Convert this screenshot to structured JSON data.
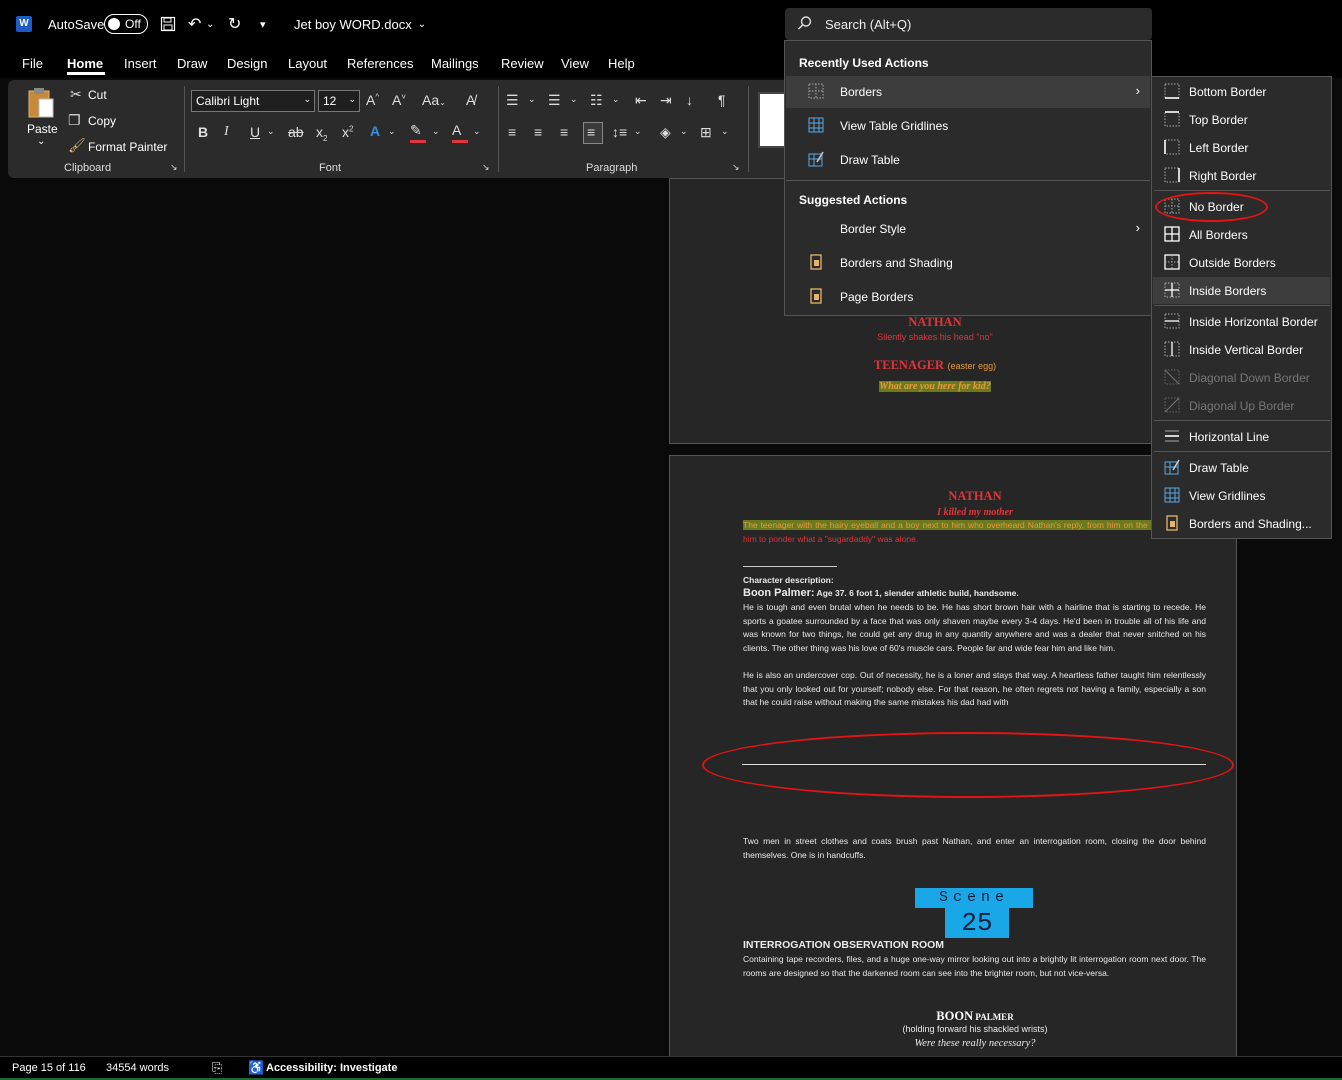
{
  "titlebar": {
    "autosave_label": "AutoSave",
    "autosave_state": "Off",
    "doc_title": "Jet boy WORD.docx"
  },
  "search": {
    "placeholder": "Search (Alt+Q)"
  },
  "tabs": [
    "File",
    "Home",
    "Insert",
    "Draw",
    "Design",
    "Layout",
    "References",
    "Mailings",
    "Review",
    "View",
    "Help"
  ],
  "ribbon": {
    "paste": "Paste",
    "cut": "Cut",
    "copy": "Copy",
    "format_painter": "Format Painter",
    "clipboard": "Clipboard",
    "font_name": "Calibri Light",
    "font_size": "12",
    "font_group": "Font",
    "paragraph_group": "Paragraph"
  },
  "search_menu": {
    "recent_heading": "Recently Used Actions",
    "recent": [
      {
        "label": "Borders",
        "icon": "borders-icon",
        "submenu": true
      },
      {
        "label": "View Table Gridlines",
        "icon": "table-gridlines-icon"
      },
      {
        "label": "Draw Table",
        "icon": "draw-table-icon"
      }
    ],
    "suggested_heading": "Suggested Actions",
    "suggested": [
      {
        "label": "Border Style",
        "icon": "",
        "submenu": true
      },
      {
        "label": "Borders and Shading",
        "icon": "document-icon"
      },
      {
        "label": "Page Borders",
        "icon": "document-icon"
      }
    ]
  },
  "border_menu": {
    "items": [
      {
        "label": "Bottom Border",
        "accel": "B",
        "rest": "ottom Border"
      },
      {
        "label": "Top Border",
        "accel": "P",
        "pre": "To",
        "rest": " Border"
      },
      {
        "label": "Left Border",
        "accel": "L",
        "rest": "eft Border"
      },
      {
        "label": "Right Border",
        "accel": "R",
        "rest": "ight Border"
      },
      {
        "label": "No Border",
        "accel": "N",
        "rest": "o Border"
      },
      {
        "label": "All Borders",
        "accel": "A",
        "rest": "ll Borders"
      },
      {
        "label": "Outside Borders",
        "accel": "S",
        "pre": "Out",
        "rest": "ide Borders"
      },
      {
        "label": "Inside Borders",
        "accel": "I",
        "rest": "nside Borders"
      },
      {
        "label": "Inside Horizontal Border",
        "accel": "H",
        "pre": "Inside ",
        "rest": "orizontal Border"
      },
      {
        "label": "Inside Vertical Border",
        "accel": "V",
        "pre": "Inside ",
        "rest": "ertical Border"
      },
      {
        "label": "Diagonal Down Border",
        "accel": "W",
        "pre": "Diagonal Do",
        "rest": "n Border"
      },
      {
        "label": "Diagonal Up Border",
        "accel": "U",
        "pre": "Diagonal ",
        "rest": "p Border"
      },
      {
        "label": "Horizontal Line",
        "accel": "Z",
        "pre": "Hori",
        "rest": "ontal Line"
      },
      {
        "label": "Draw Table",
        "accel": "D",
        "rest": "raw Table"
      },
      {
        "label": "View Gridlines",
        "accel": "G",
        "pre": "View ",
        "rest": "ridlines"
      },
      {
        "label": "Borders and Shading...",
        "accel": "O",
        "pre": "B",
        "rest": "rders and Shading..."
      }
    ]
  },
  "page1": {
    "nathan": "NATHAN",
    "nathan_action": "Silently shakes his head \"no\"",
    "teenager": "TEENAGER",
    "teenager_note": "(easter egg)",
    "teenager_line": "What are you here for kid?"
  },
  "page2": {
    "nathan": "NATHAN",
    "nathan_line": "I killed my mother",
    "highlight_text": "The teenager with the hairy eyeball and a boy next to him who overheard Nathan's reply, from him on the bench,",
    "after_highlight": " leaving him to ponder what a \"sugardaddy\" was alone.",
    "char_desc_label": "Character description:",
    "boon_heading": "Boon  Palmer:",
    "boon_detail": " Age 37. 6 foot 1, slender athletic build, handsome.",
    "para1": "He is tough and even brutal when he needs to be. He has short brown hair with a hairline that is starting to recede. He sports a goatee surrounded by a face that was only shaven maybe every 3-4 days. He'd been in trouble all of his life and was known for two things, he could get any drug in any quantity anywhere and was a dealer that never snitched on his clients. The other thing was his love of 60's muscle cars. People far and wide fear him and like him.",
    "para2": "He is also an undercover cop. Out of necessity, he is a loner and stays that way. A heartless father taught him relentlessly that you only looked out for yourself; nobody else. For that reason, he often regrets not having a family, especially a son that he could raise without making the same mistakes his dad had with",
    "para3": "Two men in street clothes and coats brush past Nathan, and enter an interrogation room, closing the door behind themselves. One is in handcuffs.",
    "scene_word": "Scene",
    "scene_num": "25",
    "location": "INTERROGATION OBSERVATION ROOM",
    "para4": "Containing tape recorders, files, and a huge one-way mirror looking out into a brightly lit interrogation room next door. The rooms are designed so that the darkened room can see into the brighter room, but not vice-versa.",
    "boon_name": "BOON",
    "boon_name2": " PALMER",
    "boon_paren": "(holding forward his shackled wrists)",
    "boon_line": "Were these really necessary?"
  },
  "status": {
    "page": "Page 15 of 116",
    "words": "34554 words",
    "accessibility": "Accessibility: Investigate"
  },
  "colors": {
    "accent_red": "#e0353b",
    "highlight_olive": "#6b7a1f",
    "highlight_text": "#e99a3a",
    "scene_blue": "#1aa7e8"
  }
}
